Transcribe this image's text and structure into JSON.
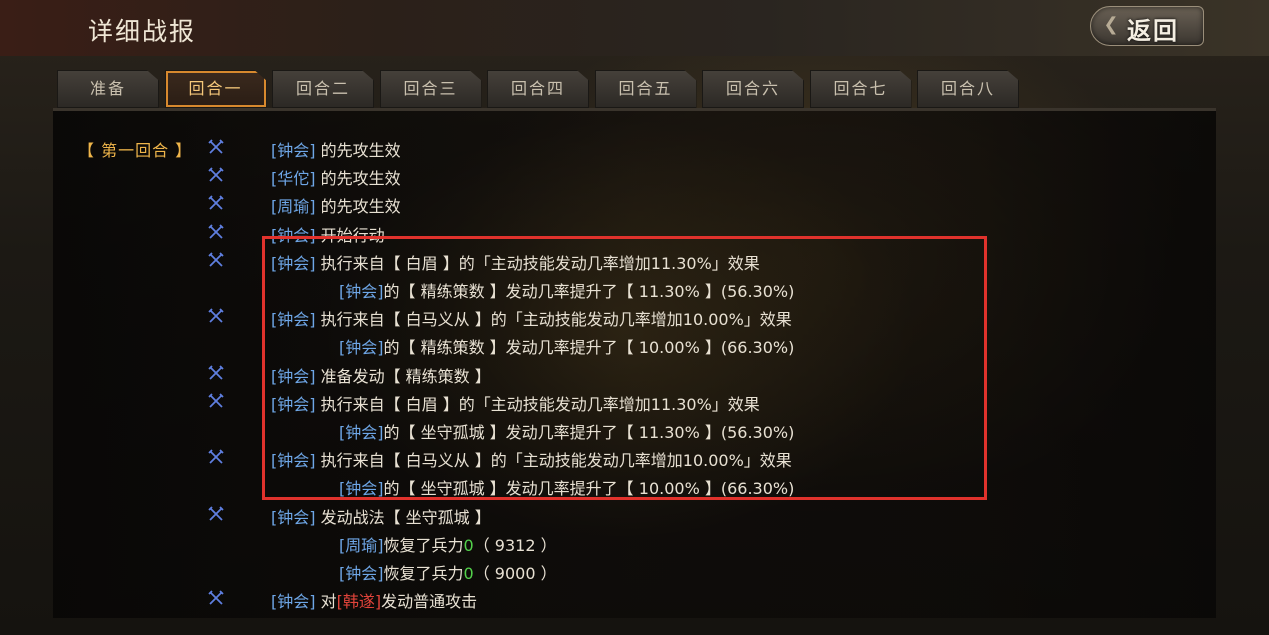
{
  "header": {
    "title": "详细战报",
    "back_label": "返回",
    "back_ornament": "❮"
  },
  "tabs": [
    {
      "label": "准备",
      "active": false
    },
    {
      "label": "回合一",
      "active": true
    },
    {
      "label": "回合二",
      "active": false
    },
    {
      "label": "回合三",
      "active": false
    },
    {
      "label": "回合四",
      "active": false
    },
    {
      "label": "回合五",
      "active": false
    },
    {
      "label": "回合六",
      "active": false
    },
    {
      "label": "回合七",
      "active": false
    },
    {
      "label": "回合八",
      "active": false
    }
  ],
  "round": {
    "label": "【 第一回合 】"
  },
  "log": [
    {
      "icon": true,
      "indent": 0,
      "parts": [
        {
          "t": "[钟会]",
          "c": "blue"
        },
        {
          "t": " 的先攻生效",
          "c": ""
        }
      ]
    },
    {
      "icon": true,
      "indent": 0,
      "parts": [
        {
          "t": "[华佗]",
          "c": "blue"
        },
        {
          "t": " 的先攻生效",
          "c": ""
        }
      ]
    },
    {
      "icon": true,
      "indent": 0,
      "parts": [
        {
          "t": "[周瑜]",
          "c": "blue"
        },
        {
          "t": " 的先攻生效",
          "c": ""
        }
      ]
    },
    {
      "icon": true,
      "indent": 0,
      "parts": [
        {
          "t": "[钟会]",
          "c": "blue"
        },
        {
          "t": " 开始行动",
          "c": ""
        }
      ]
    },
    {
      "icon": true,
      "indent": 0,
      "parts": [
        {
          "t": "[钟会]",
          "c": "blue"
        },
        {
          "t": " 执行来自【 白眉 】的「主动技能发动几率增加11.30%」效果",
          "c": ""
        }
      ]
    },
    {
      "icon": false,
      "indent": 1,
      "parts": [
        {
          "t": "[钟会]",
          "c": "blue"
        },
        {
          "t": "的【 精练策数 】发动几率提升了【 11.30% 】(56.30%)",
          "c": ""
        }
      ]
    },
    {
      "icon": true,
      "indent": 0,
      "parts": [
        {
          "t": "[钟会]",
          "c": "blue"
        },
        {
          "t": " 执行来自【 白马义从 】的「主动技能发动几率增加10.00%」效果",
          "c": ""
        }
      ]
    },
    {
      "icon": false,
      "indent": 1,
      "parts": [
        {
          "t": "[钟会]",
          "c": "blue"
        },
        {
          "t": "的【 精练策数 】发动几率提升了【 10.00% 】(66.30%)",
          "c": ""
        }
      ]
    },
    {
      "icon": true,
      "indent": 0,
      "parts": [
        {
          "t": "[钟会]",
          "c": "blue"
        },
        {
          "t": " 准备发动【 精练策数 】",
          "c": ""
        }
      ]
    },
    {
      "icon": true,
      "indent": 0,
      "parts": [
        {
          "t": "[钟会]",
          "c": "blue"
        },
        {
          "t": " 执行来自【 白眉 】的「主动技能发动几率增加11.30%」效果",
          "c": ""
        }
      ]
    },
    {
      "icon": false,
      "indent": 1,
      "parts": [
        {
          "t": "[钟会]",
          "c": "blue"
        },
        {
          "t": "的【 坐守孤城 】发动几率提升了【 11.30% 】(56.30%)",
          "c": ""
        }
      ]
    },
    {
      "icon": true,
      "indent": 0,
      "parts": [
        {
          "t": "[钟会]",
          "c": "blue"
        },
        {
          "t": " 执行来自【 白马义从 】的「主动技能发动几率增加10.00%」效果",
          "c": ""
        }
      ]
    },
    {
      "icon": false,
      "indent": 1,
      "parts": [
        {
          "t": "[钟会]",
          "c": "blue"
        },
        {
          "t": "的【 坐守孤城 】发动几率提升了【 10.00% 】(66.30%)",
          "c": ""
        }
      ]
    },
    {
      "icon": true,
      "indent": 0,
      "parts": [
        {
          "t": "[钟会]",
          "c": "blue"
        },
        {
          "t": " 发动战法【 坐守孤城 】",
          "c": ""
        }
      ]
    },
    {
      "icon": false,
      "indent": 1,
      "parts": [
        {
          "t": "[周瑜]",
          "c": "blue"
        },
        {
          "t": "恢复了兵力",
          "c": ""
        },
        {
          "t": "0",
          "c": "green"
        },
        {
          "t": "（ 9312 ）",
          "c": ""
        }
      ]
    },
    {
      "icon": false,
      "indent": 1,
      "parts": [
        {
          "t": "[钟会]",
          "c": "blue"
        },
        {
          "t": "恢复了兵力",
          "c": ""
        },
        {
          "t": "0",
          "c": "green"
        },
        {
          "t": "（ 9000 ）",
          "c": ""
        }
      ]
    },
    {
      "icon": true,
      "indent": 0,
      "parts": [
        {
          "t": "[钟会]",
          "c": "blue"
        },
        {
          "t": " 对",
          "c": ""
        },
        {
          "t": "[韩遂]",
          "c": "red"
        },
        {
          "t": "发动普通攻击",
          "c": ""
        }
      ]
    }
  ],
  "icon_name": "crossed-swords-icon",
  "colors": {
    "accent": "#efb54a",
    "highlight_border": "#e0322c",
    "name_blue": "#6ea6e6"
  }
}
